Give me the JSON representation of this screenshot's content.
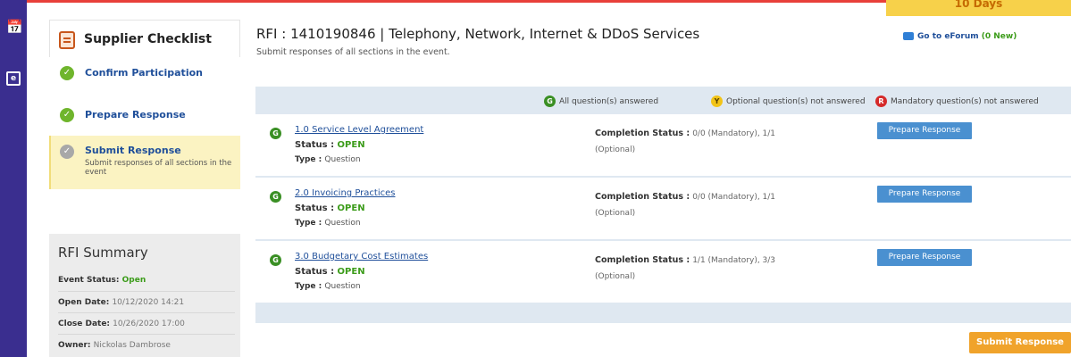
{
  "rail": {
    "icons": [
      "calendar-icon",
      "document-icon"
    ]
  },
  "banner": {
    "days_text": "10 Days"
  },
  "checklist": {
    "title": "Supplier Checklist",
    "steps": [
      {
        "label": "Confirm Participation",
        "status": "done"
      },
      {
        "label": "Prepare Response",
        "status": "done"
      },
      {
        "label": "Submit Response",
        "status": "current",
        "desc": "Submit responses of all sections in the event"
      }
    ]
  },
  "summary": {
    "title": "RFI Summary",
    "rows": [
      {
        "label": "Event Status:",
        "value": "Open"
      },
      {
        "label": "Open Date:",
        "value": "10/12/2020 14:21"
      },
      {
        "label": "Close Date:",
        "value": "10/26/2020 17:00"
      },
      {
        "label": "Owner:",
        "value": "Nickolas Dambrose"
      }
    ]
  },
  "header": {
    "title": "RFI : 1410190846 | Telephony, Network, Internet & DDoS Services",
    "subtitle": "Submit responses of all sections in the event.",
    "forum_label": "Go to eForum",
    "forum_new": "(0 New)"
  },
  "legend": {
    "all_answered": "All question(s) answered",
    "optional_unanswered": "Optional question(s) not answered",
    "mandatory_unanswered": "Mandatory question(s) not answered",
    "badges": {
      "g": "G",
      "y": "Y",
      "r": "R"
    }
  },
  "sections": [
    {
      "badge": "G",
      "name": "1.0 Service Level Agreement",
      "status_label": "Status :",
      "status": "OPEN",
      "type_label": "Type :",
      "type": "Question",
      "completion_label": "Completion Status :",
      "completion": "0/0 (Mandatory), 1/1",
      "completion_optional": "(Optional)",
      "button": "Prepare Response"
    },
    {
      "badge": "G",
      "name": "2.0 Invoicing Practices",
      "status_label": "Status :",
      "status": "OPEN",
      "type_label": "Type :",
      "type": "Question",
      "completion_label": "Completion Status :",
      "completion": "0/0 (Mandatory), 1/1",
      "completion_optional": "(Optional)",
      "button": "Prepare Response"
    },
    {
      "badge": "G",
      "name": "3.0 Budgetary Cost Estimates",
      "status_label": "Status :",
      "status": "OPEN",
      "type_label": "Type :",
      "type": "Question",
      "completion_label": "Completion Status :",
      "completion": "1/1 (Mandatory), 3/3",
      "completion_optional": "(Optional)",
      "button": "Prepare Response"
    }
  ],
  "footer": {
    "submit_label": "Submit Response"
  },
  "colors": {
    "rail": "#3a2e8f",
    "accent_orange": "#f0a32b",
    "link_blue": "#1f4f9a",
    "open_green": "#3c9c1a"
  }
}
